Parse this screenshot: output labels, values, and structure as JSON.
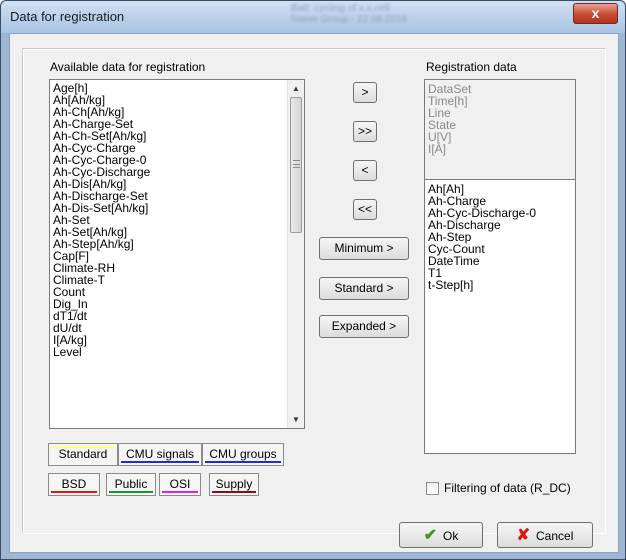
{
  "window": {
    "title": "Data for registration",
    "close_glyph": "x",
    "blurred_info": [
      "Batt: cycling of x.x.cell",
      "Name Group - 22.08.2016"
    ]
  },
  "available": {
    "label": "Available data for registration",
    "items": [
      "Age[h]",
      "Ah[Ah/kg]",
      "Ah-Ch[Ah/kg]",
      "Ah-Charge-Set",
      "Ah-Ch-Set[Ah/kg]",
      "Ah-Cyc-Charge",
      "Ah-Cyc-Charge-0",
      "Ah-Cyc-Discharge",
      "Ah-Dis[Ah/kg]",
      "Ah-Discharge-Set",
      "Ah-Dis-Set[Ah/kg]",
      "Ah-Set",
      "Ah-Set[Ah/kg]",
      "Ah-Step[Ah/kg]",
      "Cap[F]",
      "Climate-RH",
      "Climate-T",
      "Count",
      "Dig_In",
      "dT1/dt",
      "dU/dt",
      "I[A/kg]",
      "Level"
    ]
  },
  "move_buttons": {
    "add_one": ">",
    "add_all": ">>",
    "remove_one": "<",
    "remove_all": "<<",
    "minimum": "Minimum >",
    "standard": "Standard >",
    "expanded": "Expanded >"
  },
  "registration": {
    "label": "Registration data",
    "fixed_items": [
      "DataSet",
      "Time[h]",
      "Line",
      "State",
      "U[V]",
      "I[A]"
    ],
    "items": [
      "Ah[Ah]",
      "Ah-Charge",
      "Ah-Cyc-Discharge-0",
      "Ah-Discharge",
      "Ah-Step",
      "Cyc-Count",
      "DateTime",
      "T1",
      "t-Step[h]"
    ]
  },
  "tabs": {
    "row1": [
      {
        "label": "Standard",
        "color": "#ffff80"
      },
      {
        "label": "CMU signals",
        "color": "#1a2fd0"
      },
      {
        "label": "CMU groups",
        "color": "#1a2fd0"
      }
    ],
    "row2": [
      {
        "label": "BSD",
        "color": "#e01515"
      },
      {
        "label": "Public",
        "color": "#159a2a"
      },
      {
        "label": "OSI",
        "color": "#e020e0"
      },
      {
        "label": "Supply",
        "color": "#8a1010"
      }
    ]
  },
  "filter": {
    "label": "Filtering of data (R_DC)",
    "checked": false
  },
  "footer": {
    "ok_label": "Ok",
    "cancel_label": "Cancel"
  }
}
